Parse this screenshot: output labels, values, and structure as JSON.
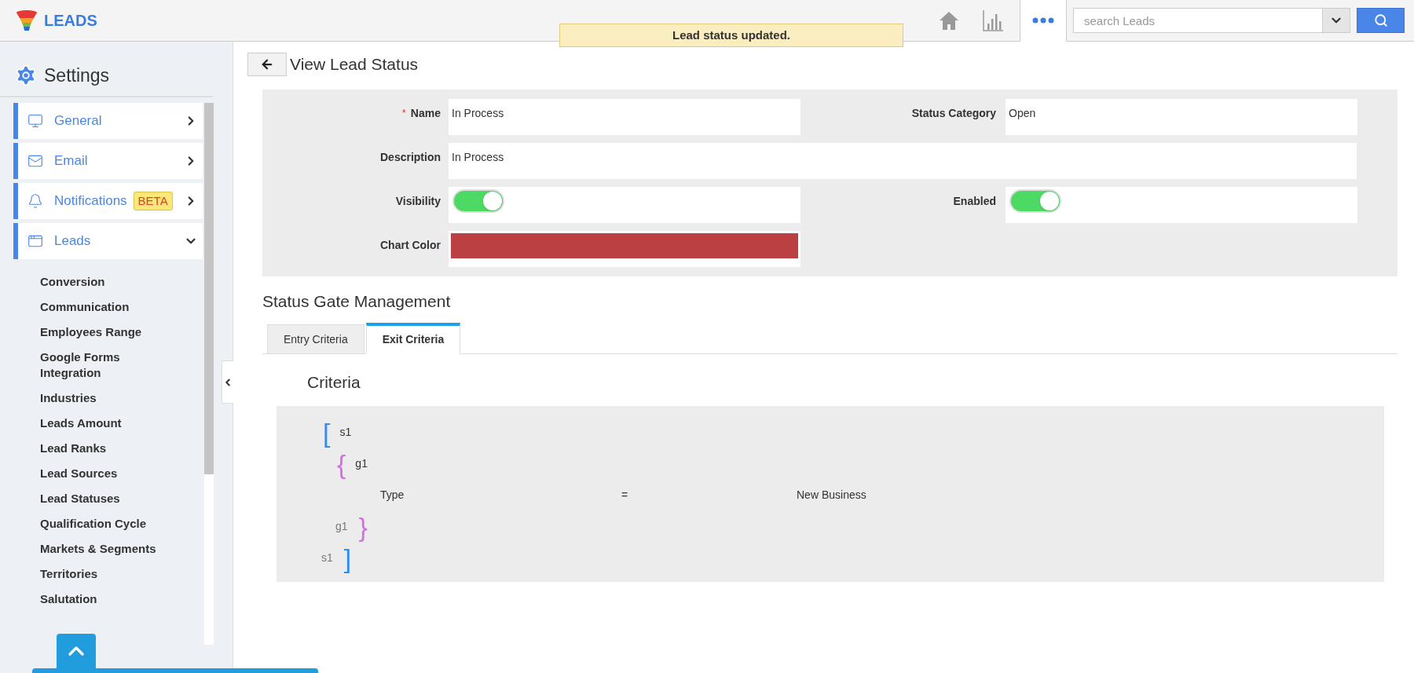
{
  "app": {
    "title": "LEADS"
  },
  "toolbar": {
    "search": {
      "placeholder": "search Leads"
    }
  },
  "toast": "Lead status updated.",
  "sidebar": {
    "title": "Settings",
    "items": [
      {
        "label": "General",
        "expanded": false
      },
      {
        "label": "Email",
        "expanded": false
      },
      {
        "label": "Notifications",
        "badge": "BETA",
        "expanded": false
      },
      {
        "label": "Leads",
        "expanded": true,
        "children": [
          "Conversion",
          "Communication",
          "Employees Range",
          "Google Forms Integration",
          "Industries",
          "Leads Amount",
          "Lead Ranks",
          "Lead Sources",
          "Lead Statuses",
          "Qualification Cycle",
          "Markets & Segments",
          "Territories",
          "Salutation"
        ]
      }
    ]
  },
  "page": {
    "title": "View Lead Status"
  },
  "form": {
    "name": {
      "label": "Name",
      "required_mark": "*",
      "value": "In Process"
    },
    "status_category": {
      "label": "Status Category",
      "value": "Open"
    },
    "description": {
      "label": "Description",
      "value": "In Process"
    },
    "visibility": {
      "label": "Visibility",
      "on": true
    },
    "enabled": {
      "label": "Enabled",
      "on": true
    },
    "chart_color": {
      "label": "Chart Color",
      "color": "#ba4041"
    }
  },
  "gate": {
    "title": "Status Gate Management",
    "tabs": [
      {
        "label": "Entry Criteria",
        "selected": false
      },
      {
        "label": "Exit Criteria",
        "selected": true
      }
    ],
    "criteria_title": "Criteria",
    "lines": [
      {
        "kind": "set_open",
        "bracket": "[",
        "label": "s1"
      },
      {
        "kind": "group_open",
        "bracket": "{",
        "label": "g1"
      },
      {
        "kind": "condition",
        "field": "Type",
        "operator": "=",
        "value": "New Business"
      },
      {
        "kind": "group_close",
        "label": "g1",
        "bracket": "}"
      },
      {
        "kind": "set_close",
        "label": "s1",
        "bracket": "]"
      }
    ]
  }
}
